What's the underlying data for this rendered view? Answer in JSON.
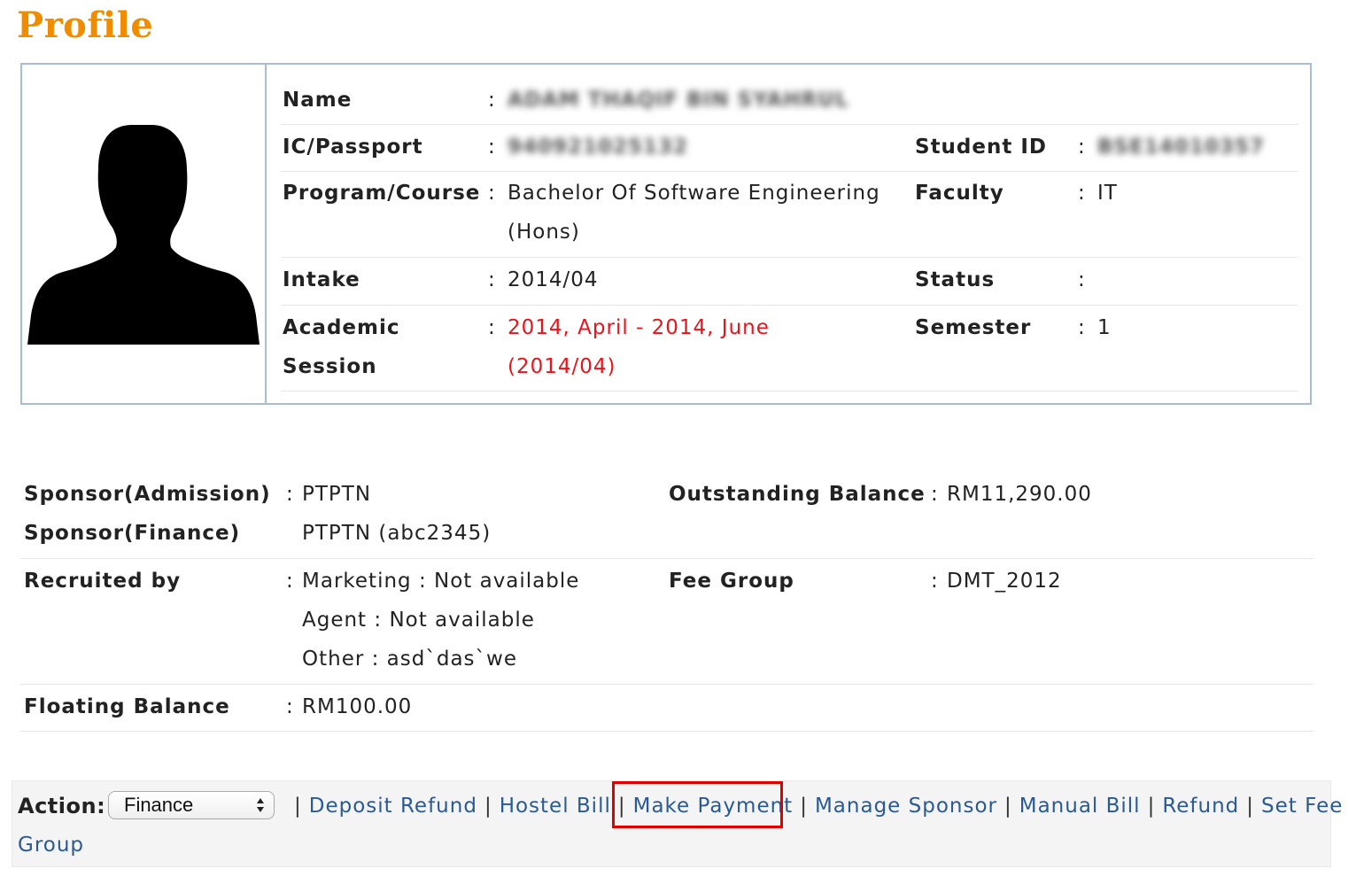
{
  "page": {
    "title": "Profile"
  },
  "profile": {
    "name_label": "Name",
    "name_value": "ADAM THAQIF BIN SYAHRUL",
    "ic_label": "IC/Passport",
    "ic_value": "940921025132",
    "student_id_label": "Student ID",
    "student_id_value": "BSE14010357",
    "program_label": "Program/Course",
    "program_value_line1": "Bachelor Of Software Engineering",
    "program_value_line2": "(Hons)",
    "faculty_label": "Faculty",
    "faculty_value": "IT",
    "intake_label": "Intake",
    "intake_value": "2014/04",
    "status_label": "Status",
    "status_value": "",
    "academic_label_line1": "Academic",
    "academic_label_line2": "Session",
    "academic_value_line1": "2014, April - 2014, June",
    "academic_value_line2": "(2014/04)",
    "semester_label": "Semester",
    "semester_value": "1",
    "colon": ":"
  },
  "finance": {
    "sponsor_admission_label": "Sponsor(Admission)",
    "sponsor_admission_value": "PTPTN",
    "sponsor_finance_label": "Sponsor(Finance)",
    "sponsor_finance_value": "PTPTN (abc2345)",
    "outstanding_label": "Outstanding Balance",
    "outstanding_value": "RM11,290.00",
    "recruited_label": "Recruited by",
    "recruited_marketing": "Marketing : Not available",
    "recruited_agent": "Agent : Not available",
    "recruited_other": "Other : asd`das`we",
    "fee_group_label": "Fee Group",
    "fee_group_value": "DMT_2012",
    "floating_label": "Floating Balance",
    "floating_value": "RM100.00",
    "colon": ":"
  },
  "action": {
    "label": "Action:",
    "select_value": "Finance",
    "separator": "|",
    "links": [
      "Deposit Refund",
      "Hostel Bill",
      "Make Payment",
      "Manage Sponsor",
      "Manual Bill",
      "Refund",
      "Set Fee",
      "Group"
    ]
  },
  "colors": {
    "title": "#f08c00",
    "accent_red": "#e8141c",
    "link": "#2a5a94",
    "border": "#a9bcd2",
    "highlight": "#e00000"
  },
  "icons": {
    "avatar": "person-silhouette-icon",
    "select": "up-down-arrows-icon"
  }
}
